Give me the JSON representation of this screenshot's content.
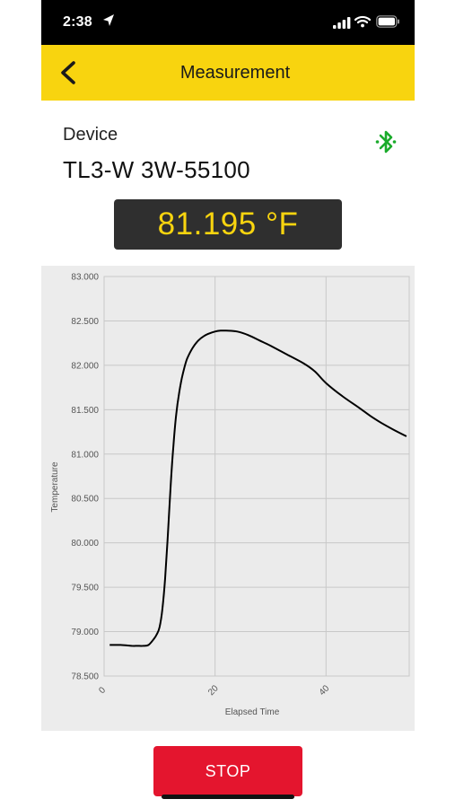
{
  "status_bar": {
    "time": "2:38",
    "icons": [
      "location-arrow-icon",
      "cellular-signal-icon",
      "wifi-icon",
      "battery-icon"
    ]
  },
  "nav": {
    "title": "Measurement",
    "back_icon": "chevron-left-icon",
    "background": "#f8d40f"
  },
  "device": {
    "label": "Device",
    "name": "TL3-W 3W-55100",
    "connection_icon": "bluetooth-icon",
    "connection_color": "#1aab2b"
  },
  "reading": {
    "value": "81.195 °F",
    "color": "#f8d40f"
  },
  "chart_data": {
    "type": "line",
    "xlabel": "Elapsed Time",
    "ylabel": "Temperature",
    "xlim": [
      0,
      55
    ],
    "ylim": [
      78.5,
      83.0
    ],
    "x_ticks": [
      0,
      20,
      40
    ],
    "x_tick_labels": [
      "0",
      "20",
      "40"
    ],
    "y_ticks": [
      78.5,
      79.0,
      79.5,
      80.0,
      80.5,
      81.0,
      81.5,
      82.0,
      82.5,
      83.0
    ],
    "y_tick_labels": [
      "78.500",
      "79.000",
      "79.500",
      "80.000",
      "80.500",
      "81.000",
      "81.500",
      "82.000",
      "82.500",
      "83.000"
    ],
    "grid": true,
    "series": [
      {
        "x": [
          1,
          3,
          5,
          6,
          7,
          8,
          9,
          9.5,
          10,
          10.5,
          11,
          11.5,
          12,
          12.5,
          13,
          13.5,
          14,
          14.5,
          15,
          16,
          17,
          18,
          19,
          20,
          21,
          22,
          24,
          26,
          28,
          30,
          33,
          36,
          38,
          40,
          43,
          46,
          48,
          50,
          52,
          54.5
        ],
        "y": [
          78.85,
          78.85,
          78.84,
          78.84,
          78.84,
          78.85,
          78.92,
          78.97,
          79.05,
          79.25,
          79.6,
          80.1,
          80.65,
          81.1,
          81.45,
          81.68,
          81.85,
          81.98,
          82.08,
          82.2,
          82.28,
          82.33,
          82.36,
          82.38,
          82.39,
          82.39,
          82.38,
          82.34,
          82.28,
          82.22,
          82.12,
          82.02,
          81.93,
          81.8,
          81.65,
          81.52,
          81.43,
          81.35,
          81.28,
          81.2
        ]
      }
    ]
  },
  "stop_button": {
    "label": "STOP",
    "color": "#e4152e"
  }
}
